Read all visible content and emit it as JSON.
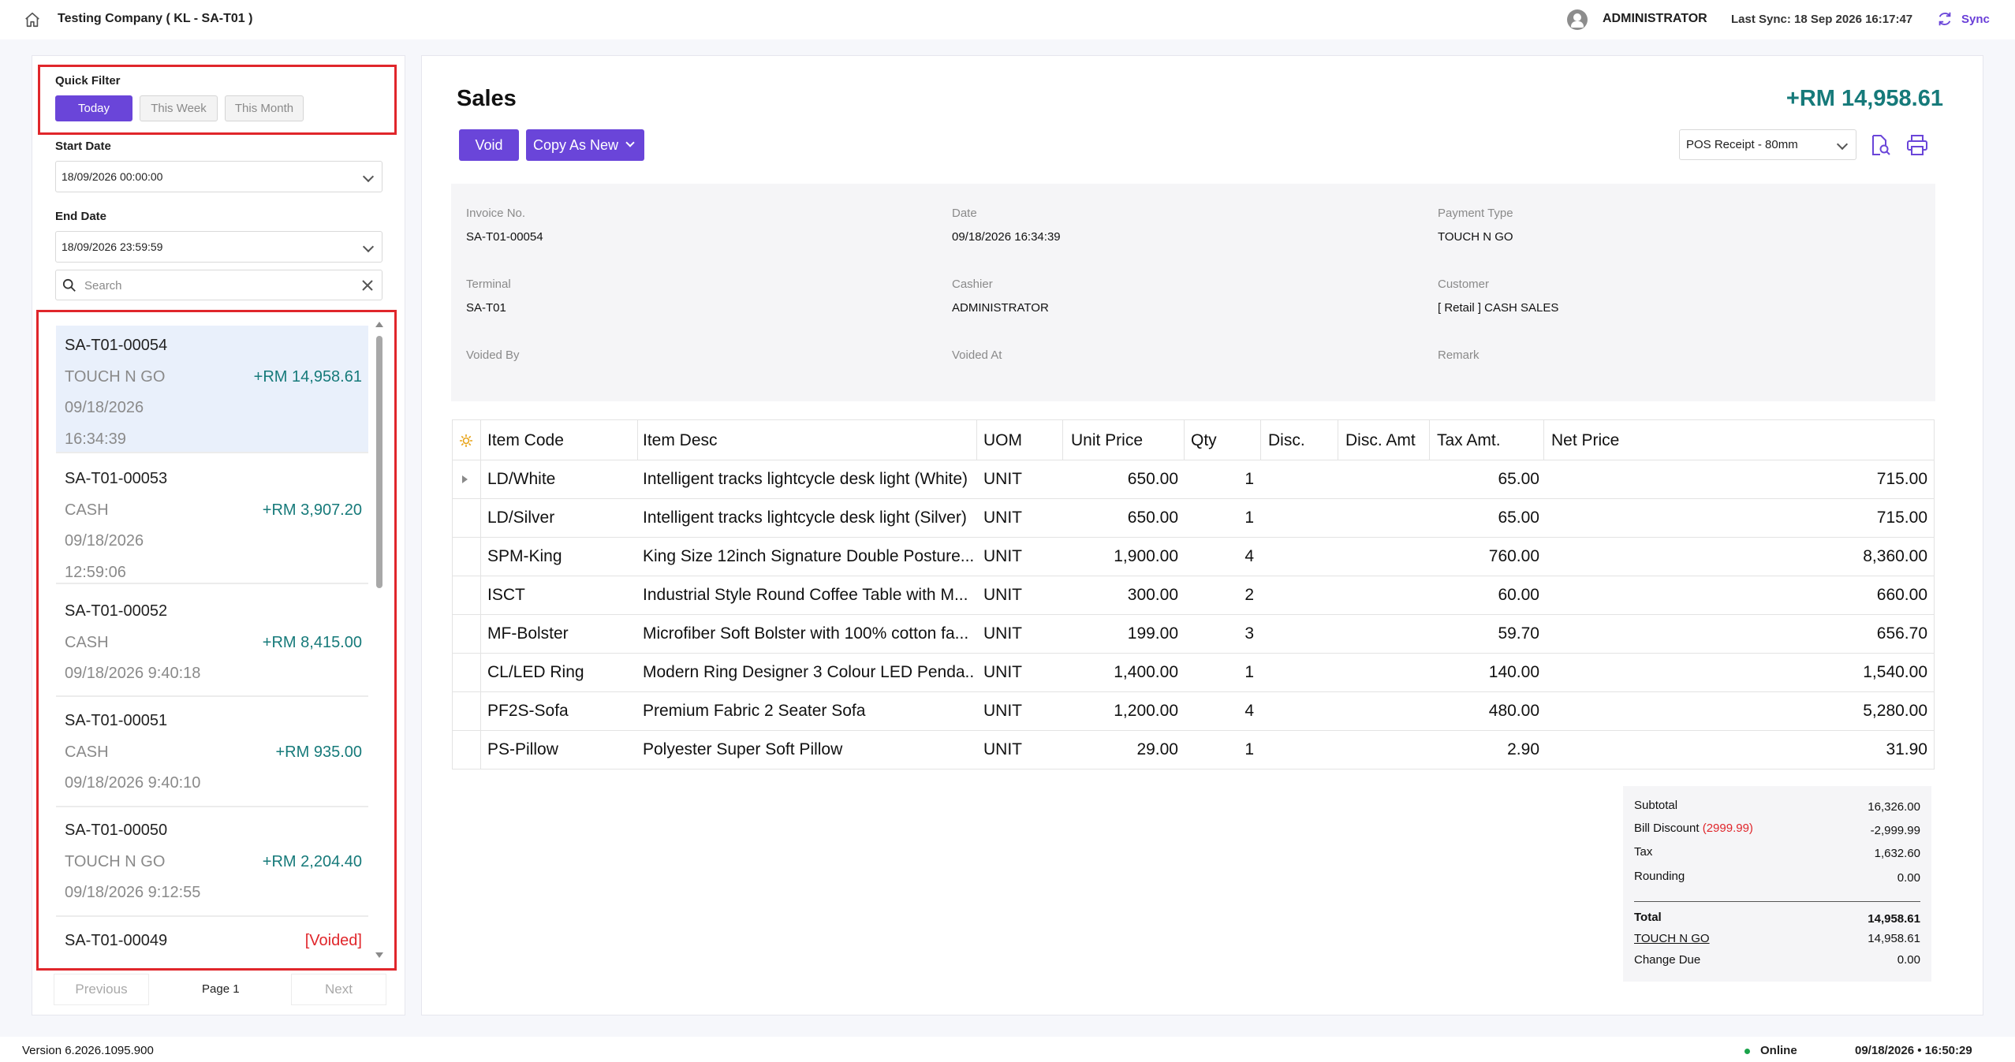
{
  "header": {
    "company": "Testing Company ( KL - SA-T01 )",
    "user": "ADMINISTRATOR",
    "last_sync": "Last Sync: 18 Sep 2026 16:17:47",
    "sync_label": "Sync"
  },
  "filter": {
    "quick_label": "Quick Filter",
    "today": "Today",
    "this_week": "This Week",
    "this_month": "This Month",
    "start_label": "Start Date",
    "start_value": "18/09/2026 00:00:00",
    "end_label": "End Date",
    "end_value": "18/09/2026 23:59:59",
    "search_placeholder": "Search"
  },
  "sales_list": [
    {
      "no": "SA-T01-00054",
      "type": "TOUCH N GO",
      "amount": "+RM 14,958.61",
      "date_l1": "09/18/2026",
      "date_l2": "16:34:39"
    },
    {
      "no": "SA-T01-00053",
      "type": "CASH",
      "amount": "+RM 3,907.20",
      "date_l1": "09/18/2026",
      "date_l2": "12:59:06"
    },
    {
      "no": "SA-T01-00052",
      "type": "CASH",
      "amount": "+RM 8,415.00",
      "date_l1": "09/18/2026 9:40:18"
    },
    {
      "no": "SA-T01-00051",
      "type": "CASH",
      "amount": "+RM 935.00",
      "date_l1": "09/18/2026 9:40:10"
    },
    {
      "no": "SA-T01-00050",
      "type": "TOUCH N GO",
      "amount": "+RM 2,204.40",
      "date_l1": "09/18/2026 9:12:55"
    },
    {
      "no": "SA-T01-00049",
      "status": "[Voided]"
    }
  ],
  "pager": {
    "previous": "Previous",
    "page": "Page 1",
    "next": "Next"
  },
  "detail": {
    "title": "Sales",
    "total": "+RM 14,958.61",
    "void_label": "Void",
    "copy_label": "Copy As New",
    "receipt_format": "POS Receipt - 80mm",
    "info": {
      "invoice_label": "Invoice No.",
      "invoice_value": "SA-T01-00054",
      "date_label": "Date",
      "date_value": "09/18/2026 16:34:39",
      "payment_label": "Payment Type",
      "payment_value": "TOUCH N GO",
      "terminal_label": "Terminal",
      "terminal_value": "SA-T01",
      "cashier_label": "Cashier",
      "cashier_value": "ADMINISTRATOR",
      "customer_label": "Customer",
      "customer_value": "[ Retail ] CASH SALES",
      "voided_by_label": "Voided By",
      "voided_at_label": "Voided At",
      "remark_label": "Remark"
    }
  },
  "table": {
    "headers": [
      "Item Code",
      "Item Desc",
      "UOM",
      "Unit Price",
      "Qty",
      "Disc.",
      "Disc. Amt",
      "Tax Amt.",
      "Net Price"
    ],
    "rows": [
      [
        "LD/White",
        "Intelligent tracks lightcycle desk light (White)",
        "UNIT",
        "650.00",
        "1",
        "",
        "",
        "65.00",
        "715.00"
      ],
      [
        "LD/Silver",
        "Intelligent tracks lightcycle desk light (Silver)",
        "UNIT",
        "650.00",
        "1",
        "",
        "",
        "65.00",
        "715.00"
      ],
      [
        "SPM-King",
        "King Size 12inch Signature Double Posture...",
        "UNIT",
        "1,900.00",
        "4",
        "",
        "",
        "760.00",
        "8,360.00"
      ],
      [
        "ISCT",
        "Industrial Style Round Coffee Table with M...",
        "UNIT",
        "300.00",
        "2",
        "",
        "",
        "60.00",
        "660.00"
      ],
      [
        "MF-Bolster",
        "Microfiber Soft Bolster with 100% cotton fa...",
        "UNIT",
        "199.00",
        "3",
        "",
        "",
        "59.70",
        "656.70"
      ],
      [
        "CL/LED Ring",
        "Modern Ring Designer 3 Colour LED Penda...",
        "UNIT",
        "1,400.00",
        "1",
        "",
        "",
        "140.00",
        "1,540.00"
      ],
      [
        "PF2S-Sofa",
        "Premium Fabric 2 Seater Sofa",
        "UNIT",
        "1,200.00",
        "4",
        "",
        "",
        "480.00",
        "5,280.00"
      ],
      [
        "PS-Pillow",
        "Polyester Super Soft Pillow",
        "UNIT",
        "29.00",
        "1",
        "",
        "",
        "2.90",
        "31.90"
      ]
    ]
  },
  "summary": {
    "subtotal_label": "Subtotal",
    "subtotal": "16,326.00",
    "bill_discount_label": "Bill Discount",
    "bill_discount_pct": "(2999.99)",
    "bill_discount": "-2,999.99",
    "tax_label": "Tax",
    "tax": "1,632.60",
    "rounding_label": "Rounding",
    "rounding": "0.00",
    "total_label": "Total",
    "total": "14,958.61",
    "payment_label": "TOUCH N GO",
    "payment": "14,958.61",
    "change_label": "Change Due",
    "change": "0.00"
  },
  "footer": {
    "version": "Version 6.2026.1095.900",
    "status": "Online",
    "clock": "09/18/2026 • 16:50:29"
  },
  "colors": {
    "accent": "#6a45d9",
    "amount_teal": "#167a7a",
    "highlight_red": "#e0262b",
    "online_green": "#1aa34a"
  }
}
